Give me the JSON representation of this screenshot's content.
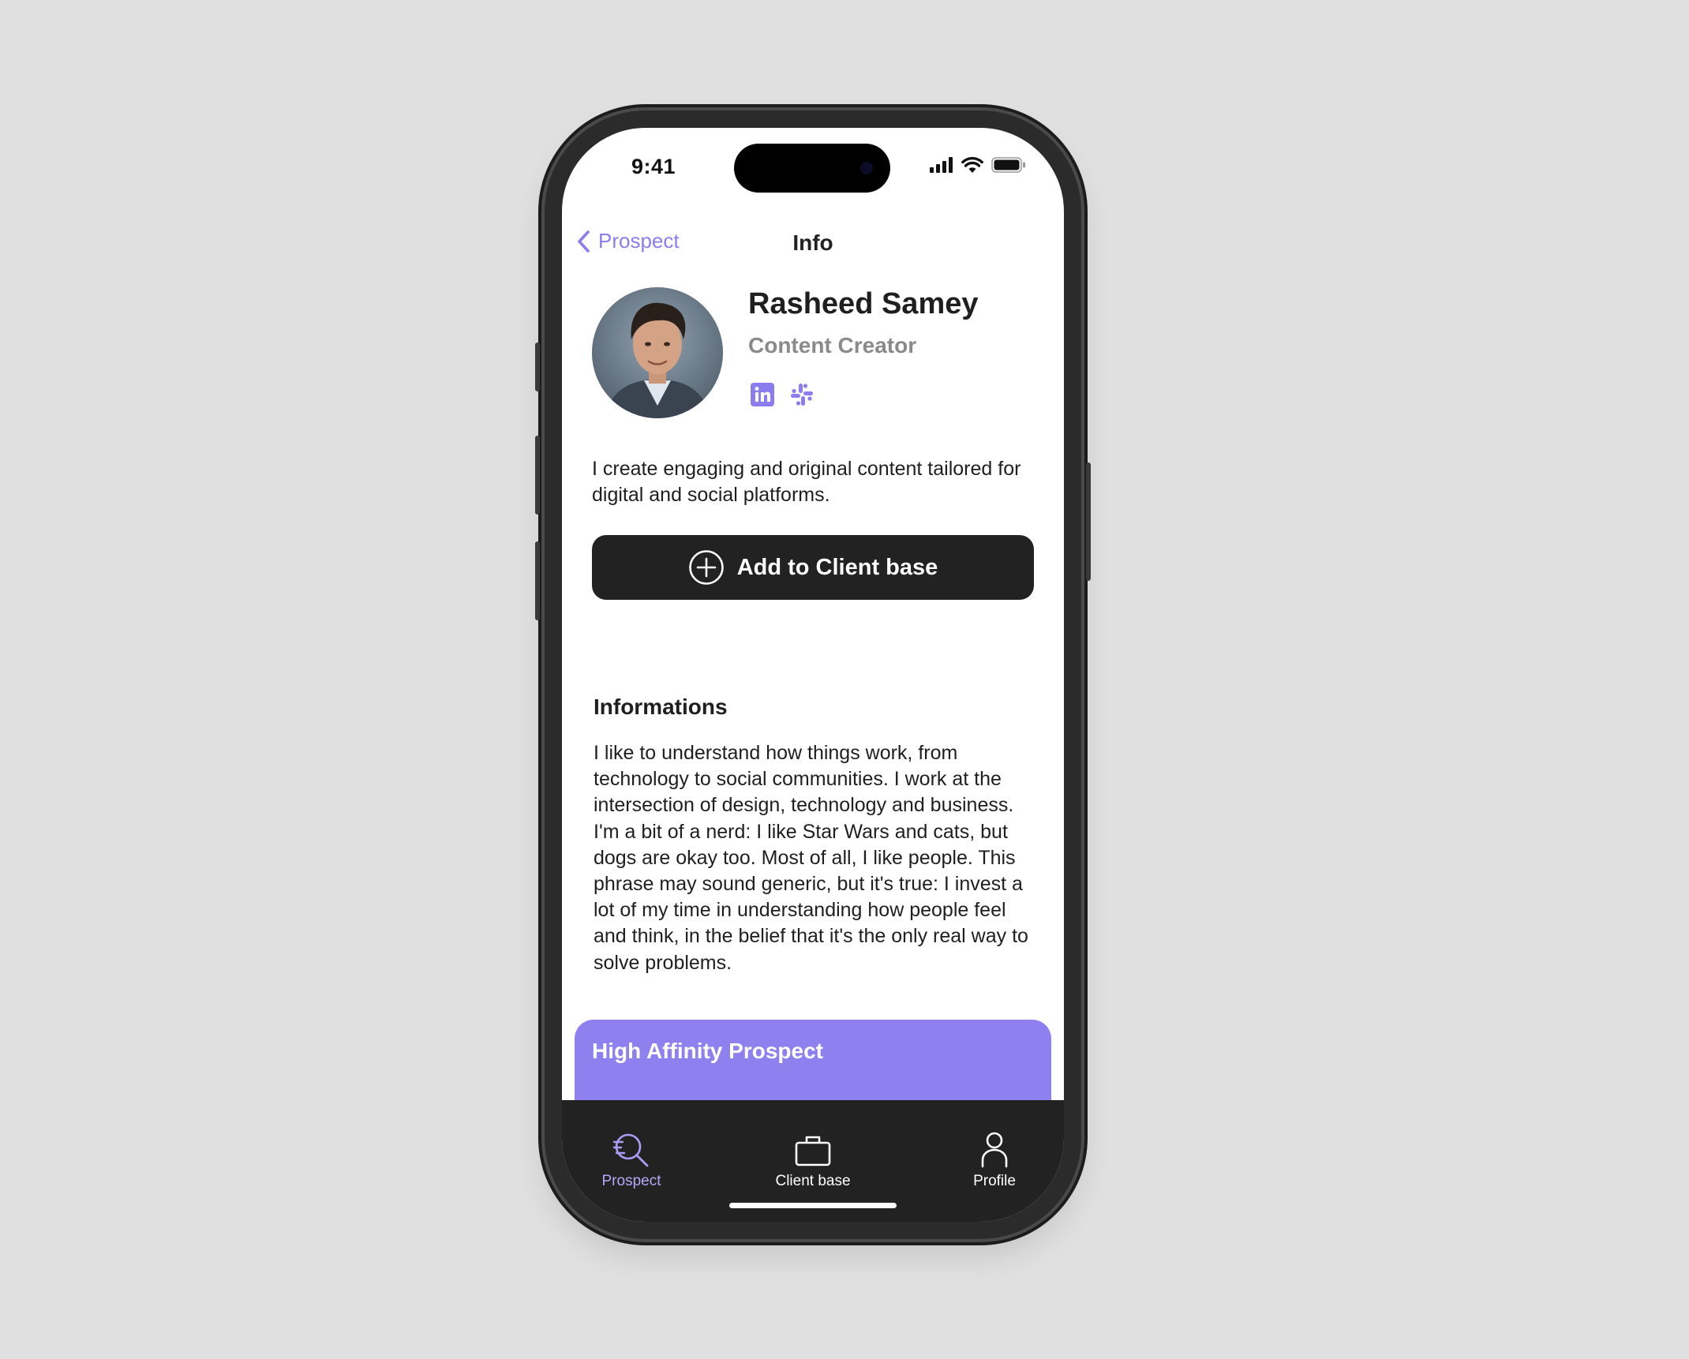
{
  "status_bar": {
    "time": "9:41"
  },
  "header": {
    "back_label": "Prospect",
    "title": "Info"
  },
  "profile": {
    "name": "Rasheed Samey",
    "role": "Content Creator",
    "bio": "I create engaging and original content tailored for digital and social platforms.",
    "socials": [
      "linkedin-icon",
      "slack-icon"
    ]
  },
  "actions": {
    "add_label": "Add to Client base"
  },
  "informations": {
    "title": "Informations",
    "text": "I like to understand how things work, from technology to social communities. I work at the intersection of design, technology and business. I'm a bit of a nerd: I like Star Wars and cats, but dogs are okay too. Most of all, I like people. This phrase may sound generic, but it's true: I invest a lot of my time in understanding how people feel and think, in the belief that it's the only real way to solve problems."
  },
  "affinity": {
    "title": "High Affinity Prospect"
  },
  "tabbar": {
    "items": [
      {
        "label": "Prospect",
        "icon": "prospect-search-icon",
        "active": true
      },
      {
        "label": "Client base",
        "icon": "briefcase-icon",
        "active": false
      },
      {
        "label": "Profile",
        "icon": "person-icon",
        "active": false
      }
    ]
  },
  "colors": {
    "accent": "#8b7df0",
    "affinity_card": "#8f80f0",
    "dark": "#222222",
    "background": "#e0e0e0"
  }
}
